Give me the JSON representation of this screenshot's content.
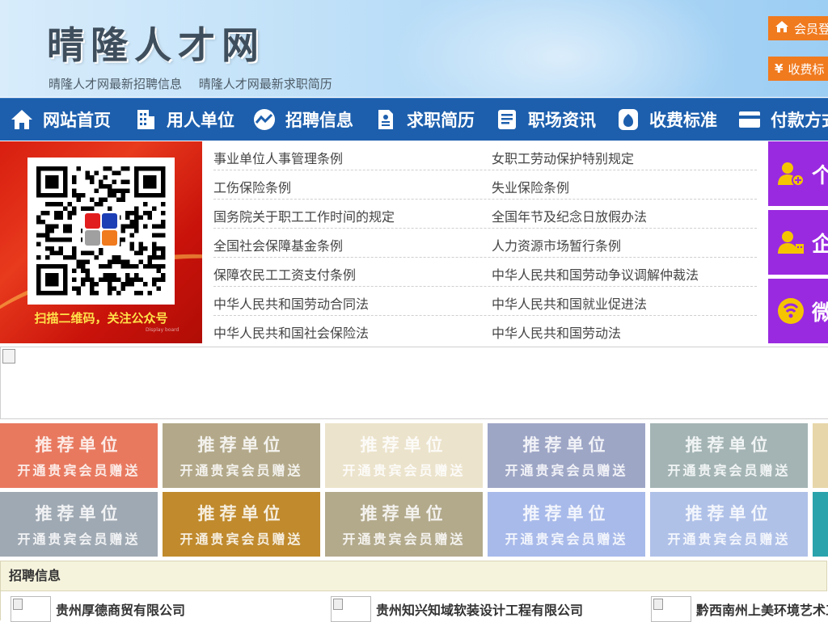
{
  "header": {
    "site_title": "晴隆人才网",
    "links": [
      "晴隆人才网最新招聘信息",
      "晴隆人才网最新求职简历"
    ],
    "member_login": "会员登",
    "fees": "收费标",
    "fees_icon": "¥"
  },
  "nav": [
    {
      "label": "网站首页",
      "icon": "home-icon"
    },
    {
      "label": "用人单位",
      "icon": "building-icon"
    },
    {
      "label": "招聘信息",
      "icon": "chart-icon"
    },
    {
      "label": "求职简历",
      "icon": "resume-icon"
    },
    {
      "label": "职场资讯",
      "icon": "news-icon"
    },
    {
      "label": "收费标准",
      "icon": "money-bag-icon"
    },
    {
      "label": "付款方式",
      "icon": "card-icon"
    }
  ],
  "qr": {
    "caption": "扫描二维码，关注公众号",
    "small_text": "Display board"
  },
  "laws": [
    [
      "事业单位人事管理条例",
      "女职工劳动保护特别规定"
    ],
    [
      "工伤保险条例",
      "失业保险条例"
    ],
    [
      "国务院关于职工工作时间的规定",
      "全国年节及纪念日放假办法"
    ],
    [
      "全国社会保障基金条例",
      "人力资源市场暂行条例"
    ],
    [
      "保障农民工工资支付条例",
      "中华人民共和国劳动争议调解仲裁法"
    ],
    [
      "中华人民共和国劳动合同法",
      "中华人民共和国就业促进法"
    ],
    [
      "中华人民共和国社会保险法",
      "中华人民共和国劳动法"
    ]
  ],
  "side_buttons": [
    {
      "label": "个",
      "icon": "person-add-icon"
    },
    {
      "label": "企",
      "icon": "company-user-icon"
    },
    {
      "label": "微",
      "icon": "wechat-icon"
    }
  ],
  "recommend": {
    "title": "推荐单位",
    "subtitle": "开通贵宾会员赠送",
    "colors_row1": [
      "#e8795f",
      "#b3a98a",
      "#ece3cc",
      "#9ea6c6",
      "#a4b4b4",
      "#e7d6a9"
    ],
    "colors_row2": [
      "#9fa9b3",
      "#c08a2d",
      "#b3aa8c",
      "#a8baea",
      "#b0c1e8",
      "#2aa3ac"
    ]
  },
  "jobs": {
    "header": "招聘信息",
    "companies": [
      "贵州厚德商贸有限公司",
      "贵州知兴知域软装设计工程有限公司",
      "黔西南州上美环境艺术工"
    ]
  }
}
